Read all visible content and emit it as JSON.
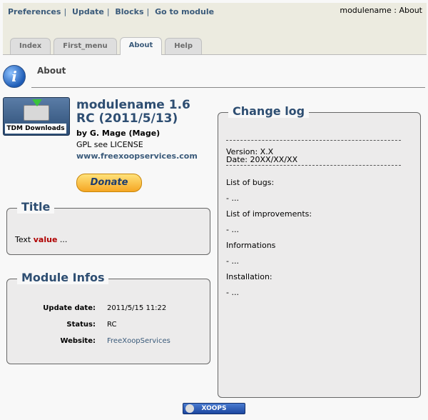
{
  "top_links": [
    "Preferences",
    "Update",
    "Blocks",
    "Go to module"
  ],
  "top_right": "modulename : About",
  "tabs": [
    {
      "label": "Index",
      "active": false
    },
    {
      "label": "First_menu",
      "active": false
    },
    {
      "label": "About",
      "active": true
    },
    {
      "label": "Help",
      "active": false
    }
  ],
  "page_title": "About",
  "logo": {
    "label": "TDM Downloads"
  },
  "module": {
    "name": "modulename 1.6 RC (2011/5/13)",
    "by": "by G. Mage (Mage)",
    "license": "GPL see LICENSE",
    "website": "www.freexoopservices.com",
    "donate": "Donate"
  },
  "title_box": {
    "legend": "Title",
    "text_prefix": "Text ",
    "text_value": "value",
    "text_suffix": " ..."
  },
  "module_infos": {
    "legend": "Module Infos",
    "rows": [
      {
        "key": "Update date:",
        "value": "2011/5/15 11:22"
      },
      {
        "key": "Status:",
        "value": "RC"
      },
      {
        "key": "Website:",
        "value": "FreeXoopServices"
      }
    ]
  },
  "changelog": {
    "legend": "Change log",
    "version": "Version: X.X",
    "date": "Date: 20XX/XX/XX",
    "sections": [
      {
        "heading": "List of bugs:",
        "item": "- ..."
      },
      {
        "heading": "List of improvements:",
        "item": "- ..."
      },
      {
        "heading": "Informations",
        "item": "- ..."
      },
      {
        "heading": "Installation:",
        "item": "- ..."
      }
    ]
  },
  "footer": {
    "badge": "XOOPS"
  }
}
